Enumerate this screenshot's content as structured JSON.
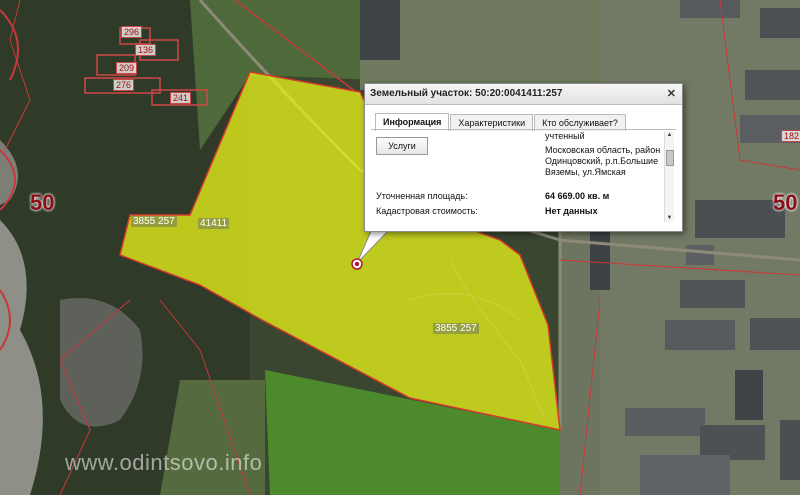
{
  "map": {
    "zone_labels": [
      "50",
      "50"
    ],
    "parcel_number": "41411",
    "plot_labels": [
      "296",
      "136",
      "209",
      "276",
      "241",
      "182",
      "3855 257",
      "3855 257"
    ],
    "watermark": "www.odintsovo.info",
    "colors": {
      "parcel_fill": "#e6ef1a",
      "parcel_border": "#d6392c",
      "cadastral_line": "#c8383a"
    }
  },
  "popup": {
    "title": "Земельный участок: 50:20:0041411:257",
    "close_icon": "close-icon",
    "tabs": [
      "Информация",
      "Характеристики",
      "Кто обслуживает?"
    ],
    "active_tab": "Информация",
    "services_button": "Услуги",
    "status_value": "учтенный",
    "address_value": "Московская область, район Одинцовский, р.п.Большие Вяземы, ул.Ямская",
    "rows": [
      {
        "label": "Уточненная площадь:",
        "value": "64 669.00 кв. м"
      },
      {
        "label": "Кадастровая стоимость:",
        "value": "Нет данных"
      }
    ]
  }
}
